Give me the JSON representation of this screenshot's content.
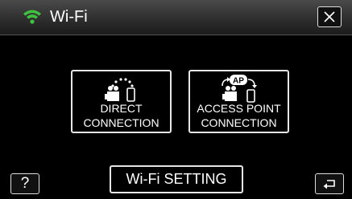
{
  "header": {
    "title": "Wi-Fi",
    "wifi_icon": "wifi-icon",
    "wifi_color": "#3fc23f",
    "close_icon": "close-icon"
  },
  "tiles": [
    {
      "line1": "DIRECT",
      "line2": "CONNECTION",
      "icon": "camera-to-phone-icon"
    },
    {
      "line1": "ACCESS POINT",
      "line2": "CONNECTION",
      "icon": "access-point-icon",
      "badge": "AP"
    }
  ],
  "footer": {
    "help_label": "?",
    "setting_label": "Wi-Fi SETTING",
    "back_icon": "return-icon"
  }
}
